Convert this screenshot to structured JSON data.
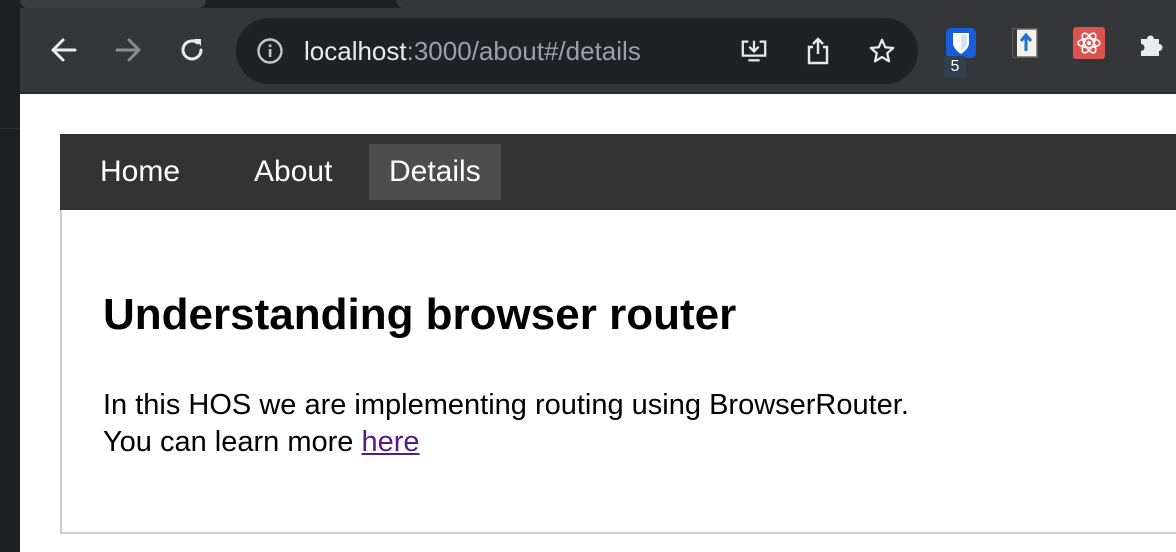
{
  "browser": {
    "url_host": "localhost",
    "url_rest": ":3000/about#/details",
    "extensions": [
      {
        "name": "bitwarden-icon",
        "badge": "5"
      },
      {
        "name": "upload-extension-icon"
      },
      {
        "name": "react-devtools-icon"
      },
      {
        "name": "extensions-puzzle-icon"
      }
    ],
    "colors": {
      "toolbar": "#35363a",
      "omnibox": "#202124",
      "url_text": "#e8eaed",
      "url_dim": "#9aa0a6"
    }
  },
  "page": {
    "nav": [
      {
        "label": "Home"
      },
      {
        "label": "About"
      },
      {
        "label": "Details",
        "active": true
      }
    ],
    "heading": "Understanding browser router",
    "paragraph_line1": "In this HOS we are implementing routing using BrowserRouter.",
    "paragraph_line2_prefix": "You can learn more",
    "link_text": "here",
    "colors": {
      "navbar": "#333333",
      "active_nav": "#4d4d4d",
      "link": "#551a8b"
    }
  }
}
